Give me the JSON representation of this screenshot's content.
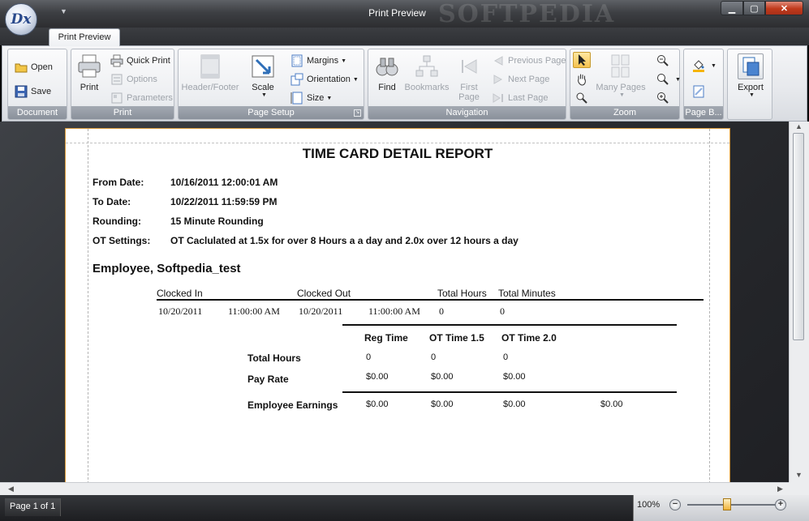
{
  "window": {
    "title": "Print Preview",
    "app_logo": "Dx",
    "controls": {
      "minimize": "▁",
      "maximize": "▢",
      "close": "✕"
    }
  },
  "watermark": "SOFTPEDIA",
  "tabs": [
    {
      "label": "Print Preview",
      "active": true
    }
  ],
  "ribbon": {
    "document": {
      "label": "Document",
      "open": "Open",
      "save": "Save"
    },
    "print": {
      "label": "Print",
      "print": "Print",
      "quick_print": "Quick Print",
      "options": "Options",
      "parameters": "Parameters"
    },
    "page_setup": {
      "label": "Page Setup",
      "header_footer": "Header/Footer",
      "scale": "Scale",
      "margins": "Margins",
      "orientation": "Orientation",
      "size": "Size"
    },
    "navigation": {
      "label": "Navigation",
      "find": "Find",
      "bookmarks": "Bookmarks",
      "first_page_1": "First",
      "first_page_2": "Page",
      "previous_page": "Previous Page",
      "next_page": "Next  Page",
      "last_page": "Last  Page"
    },
    "zoom": {
      "label": "Zoom",
      "many_pages": "Many Pages"
    },
    "page_background": {
      "label": "Page B..."
    },
    "export": {
      "label": "Export"
    }
  },
  "report": {
    "title": "TIME CARD DETAIL REPORT",
    "fields": [
      {
        "label": "From Date:",
        "value": "10/16/2011 12:00:01 AM"
      },
      {
        "label": "To Date:",
        "value": "10/22/2011 11:59:59 PM"
      },
      {
        "label": "Rounding:",
        "value": "15 Minute Rounding"
      },
      {
        "label": "OT Settings:",
        "value": "OT Caclulated at 1.5x for over 8 Hours a a day and 2.0x over 12 hours a day"
      }
    ],
    "employee": "Employee, Softpedia_test",
    "punch_columns": [
      "Clocked In",
      "Clocked Out",
      "Total Hours",
      "Total Minutes"
    ],
    "punch_row": {
      "in_date": "10/20/2011",
      "in_time": "11:00:00 AM",
      "out_date": "10/20/2011",
      "out_time": "11:00:00 AM",
      "hours": "0",
      "minutes": "0"
    },
    "summary_columns": [
      "Reg Time",
      "OT Time 1.5",
      "OT Time 2.0"
    ],
    "summary_rows": [
      {
        "label": "Total Hours",
        "values": [
          "0",
          "0",
          "0"
        ]
      },
      {
        "label": "Pay Rate",
        "values": [
          "$0.00",
          "$0.00",
          "$0.00"
        ]
      }
    ],
    "earnings": {
      "label": "Employee Earnings",
      "values": [
        "$0.00",
        "$0.00",
        "$0.00",
        "$0.00"
      ]
    }
  },
  "status": {
    "page_indicator": "Page 1 of 1",
    "zoom": "100%"
  }
}
